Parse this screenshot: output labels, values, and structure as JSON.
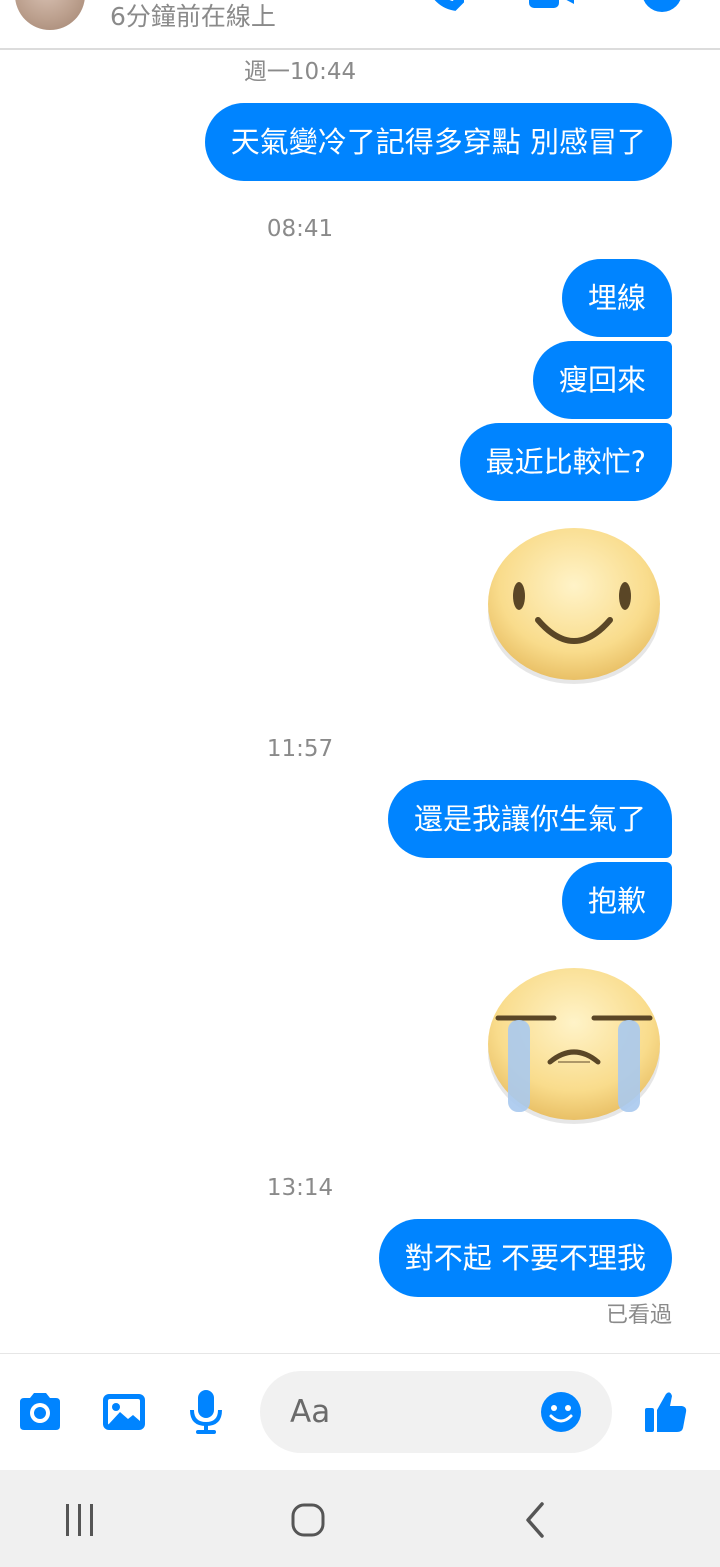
{
  "colors": {
    "accent": "#0084ff",
    "bubble_text": "#ffffff",
    "muted_text": "#8a8a8a",
    "background": "#ffffff",
    "input_bg": "#f1f1f1",
    "nav_bg": "#f0f0f0"
  },
  "header": {
    "status": "6分鐘前在線上",
    "icons": [
      "avatar",
      "phone-icon",
      "video-call-icon",
      "info-icon"
    ]
  },
  "conversation": {
    "groups": [
      {
        "timestamp": "週一10:44",
        "messages": [
          {
            "type": "text",
            "text": "天氣變冷了記得多穿點  別感冒了"
          }
        ]
      },
      {
        "timestamp": "08:41",
        "messages": [
          {
            "type": "text",
            "text": "埋線"
          },
          {
            "type": "text",
            "text": "瘦回來"
          },
          {
            "type": "text",
            "text": "最近比較忙?"
          },
          {
            "type": "sticker",
            "icon": "smiling-face-sticker-icon"
          }
        ]
      },
      {
        "timestamp": "11:57",
        "messages": [
          {
            "type": "text",
            "text": "還是我讓你生氣了"
          },
          {
            "type": "text",
            "text": "抱歉"
          },
          {
            "type": "sticker",
            "icon": "crying-face-sticker-icon"
          }
        ]
      },
      {
        "timestamp": "13:14",
        "messages": [
          {
            "type": "text",
            "text": "對不起  不要不理我"
          }
        ]
      }
    ],
    "seen_label": "已看過"
  },
  "composer": {
    "placeholder": "Aa",
    "icons": [
      "camera-icon",
      "gallery-icon",
      "microphone-icon",
      "emoji-icon",
      "thumbs-up-icon"
    ]
  },
  "system_nav": {
    "icons": [
      "recent-apps-icon",
      "home-icon",
      "back-icon"
    ]
  }
}
